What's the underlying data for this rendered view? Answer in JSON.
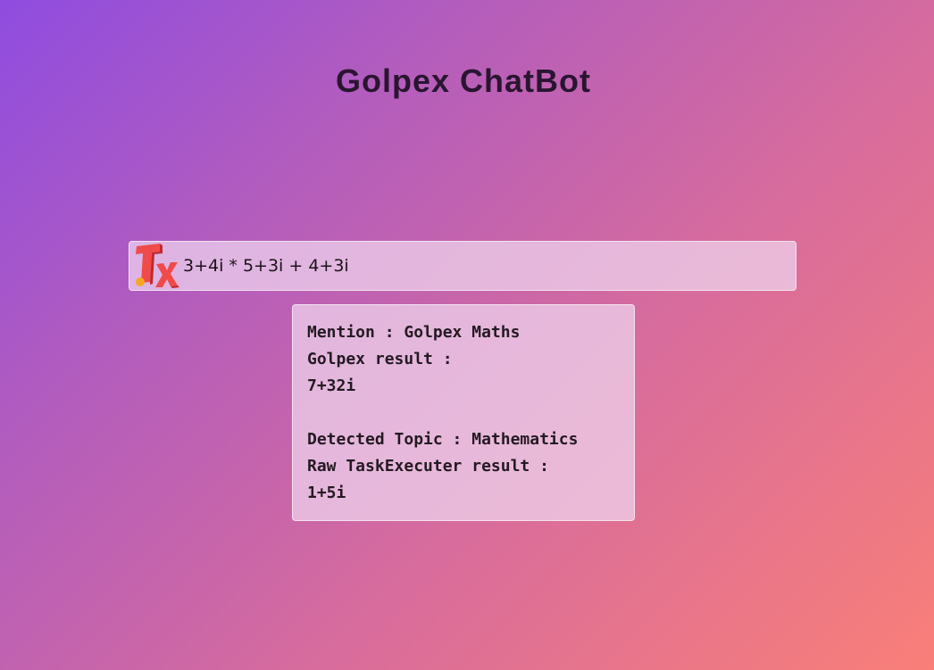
{
  "header": {
    "title": "Golpex ChatBot"
  },
  "input": {
    "logo": "tex-logo-icon",
    "value": "3+4i * 5+3i + 4+3i"
  },
  "response": {
    "lines": [
      "Mention : Golpex Maths",
      "Golpex result :",
      "7+32i",
      "",
      "Detected Topic : Mathematics",
      "Raw TaskExecuter result :",
      "1+5i"
    ]
  },
  "colors": {
    "gradient_start": "#8f4ce0",
    "gradient_end": "#f97f78",
    "logo_red": "#f04a4a",
    "logo_dot": "#f5a623"
  }
}
